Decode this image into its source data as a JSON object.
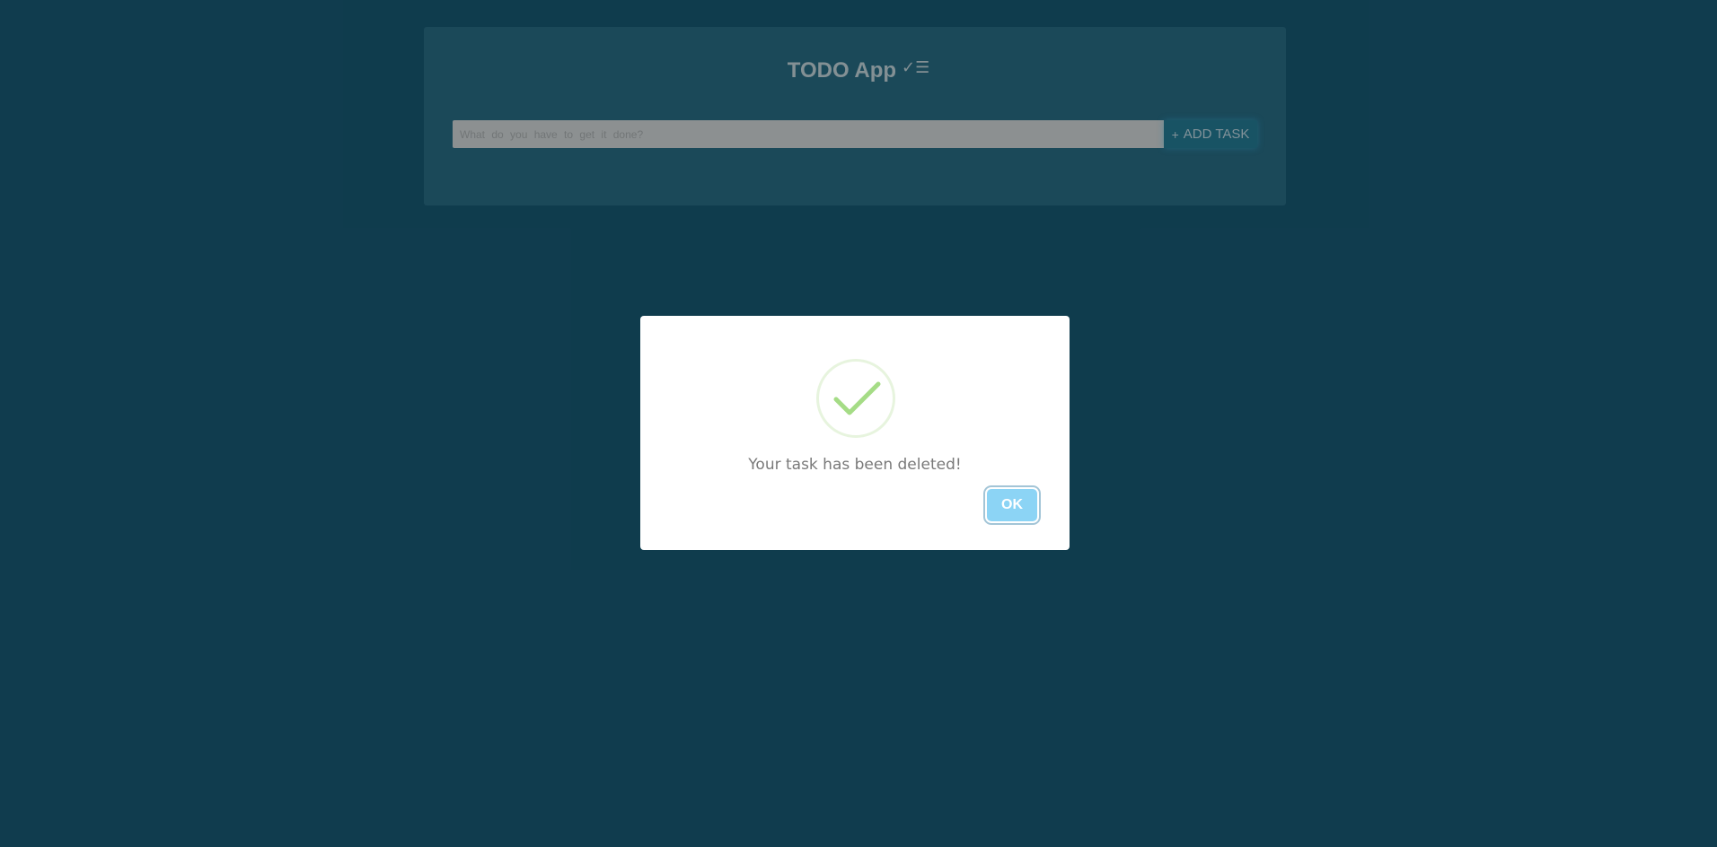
{
  "app": {
    "title": "TODO App",
    "title_icon": "✓☰",
    "task_input": {
      "placeholder": "What do you have to get it done?",
      "value": ""
    },
    "add_task_label": "ADD TASK",
    "add_task_icon": "+"
  },
  "modal": {
    "icon": "success-checkmark-icon",
    "message": "Your task has been deleted!",
    "ok_label": "OK"
  },
  "colors": {
    "background": "#103c4e",
    "panel": "#1d4a5b",
    "ok_button": "#8cd4f5",
    "success_check": "#a5dc86"
  }
}
